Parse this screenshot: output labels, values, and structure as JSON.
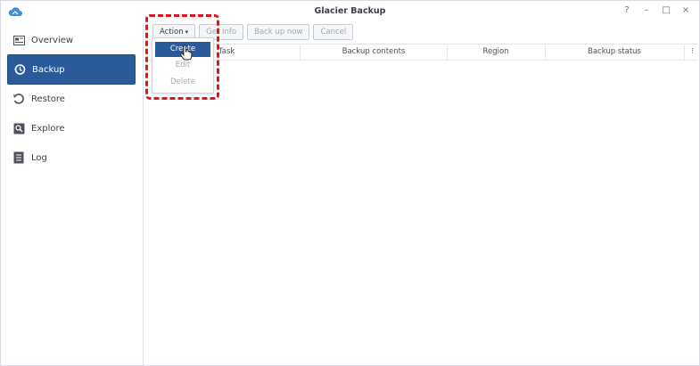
{
  "window": {
    "title": "Glacier Backup"
  },
  "window_controls": {
    "help": "?",
    "minimize": "–",
    "maximize": "□",
    "close": "×"
  },
  "sidebar": {
    "items": [
      {
        "label": "Overview",
        "icon": "overview-icon",
        "active": false
      },
      {
        "label": "Backup",
        "icon": "backup-icon",
        "active": true
      },
      {
        "label": "Restore",
        "icon": "restore-icon",
        "active": false
      },
      {
        "label": "Explore",
        "icon": "explore-icon",
        "active": false
      },
      {
        "label": "Log",
        "icon": "log-icon",
        "active": false
      }
    ]
  },
  "toolbar": {
    "action_label": "Action",
    "get_info_label": "Get Info",
    "back_up_now_label": "Back up now",
    "cancel_label": "Cancel"
  },
  "table": {
    "columns": [
      "Task",
      "Backup contents",
      "Region",
      "Backup status"
    ],
    "column_menu_icon": "⁝"
  },
  "action_menu": {
    "items": [
      {
        "label": "Create",
        "highlighted": true
      },
      {
        "label": "Edit",
        "highlighted": false
      },
      {
        "label": "Delete",
        "highlighted": false
      }
    ]
  },
  "colors": {
    "accent": "#2b5a9b",
    "annotation": "#e3121c"
  }
}
